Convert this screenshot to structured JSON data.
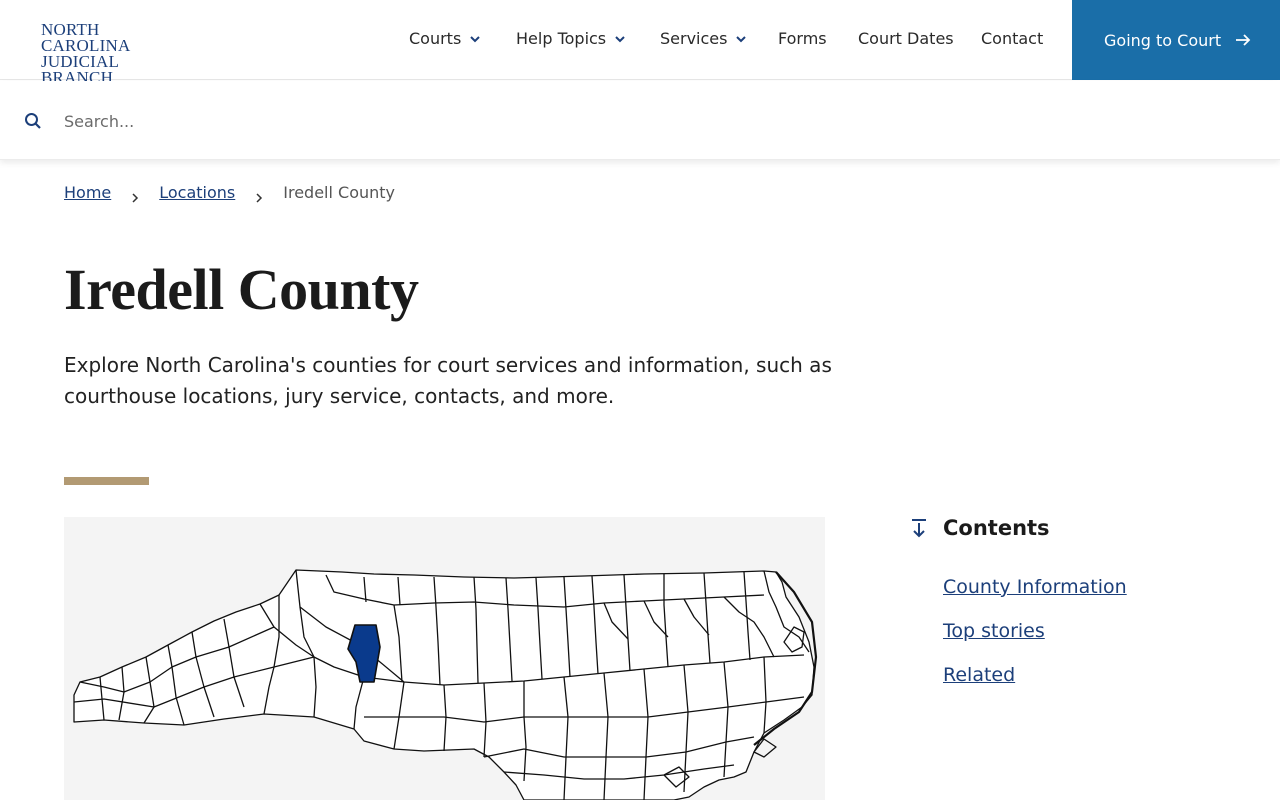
{
  "header": {
    "logo_line1": "NORTH CAROLINA",
    "logo_line2": "JUDICIAL BRANCH",
    "nav": [
      {
        "label": "Courts",
        "dropdown": true
      },
      {
        "label": "Help Topics",
        "dropdown": true
      },
      {
        "label": "Services",
        "dropdown": true
      },
      {
        "label": "Forms",
        "dropdown": false
      },
      {
        "label": "Court Dates",
        "dropdown": false
      },
      {
        "label": "Contact",
        "dropdown": false
      }
    ],
    "cta_label": "Going to Court",
    "cta_color": "#1a6ea8"
  },
  "search": {
    "placeholder": "Search..."
  },
  "breadcrumb": {
    "home": "Home",
    "locations": "Locations",
    "current": "Iredell County"
  },
  "page": {
    "title": "Iredell County",
    "intro": "Explore North Carolina's counties for court services and information, such as courthouse locations, jury service, contacts, and more.",
    "accent_color": "#b29a73"
  },
  "map": {
    "highlighted_county": "Iredell County",
    "highlight_color": "#0a3a8c"
  },
  "contents": {
    "title": "Contents",
    "items": [
      "County Information",
      "Top stories",
      "Related"
    ]
  },
  "icons": [
    "chevron-down-icon",
    "arrow-right-icon",
    "search-icon",
    "chevron-right-icon",
    "arrow-down-to-line-icon"
  ]
}
